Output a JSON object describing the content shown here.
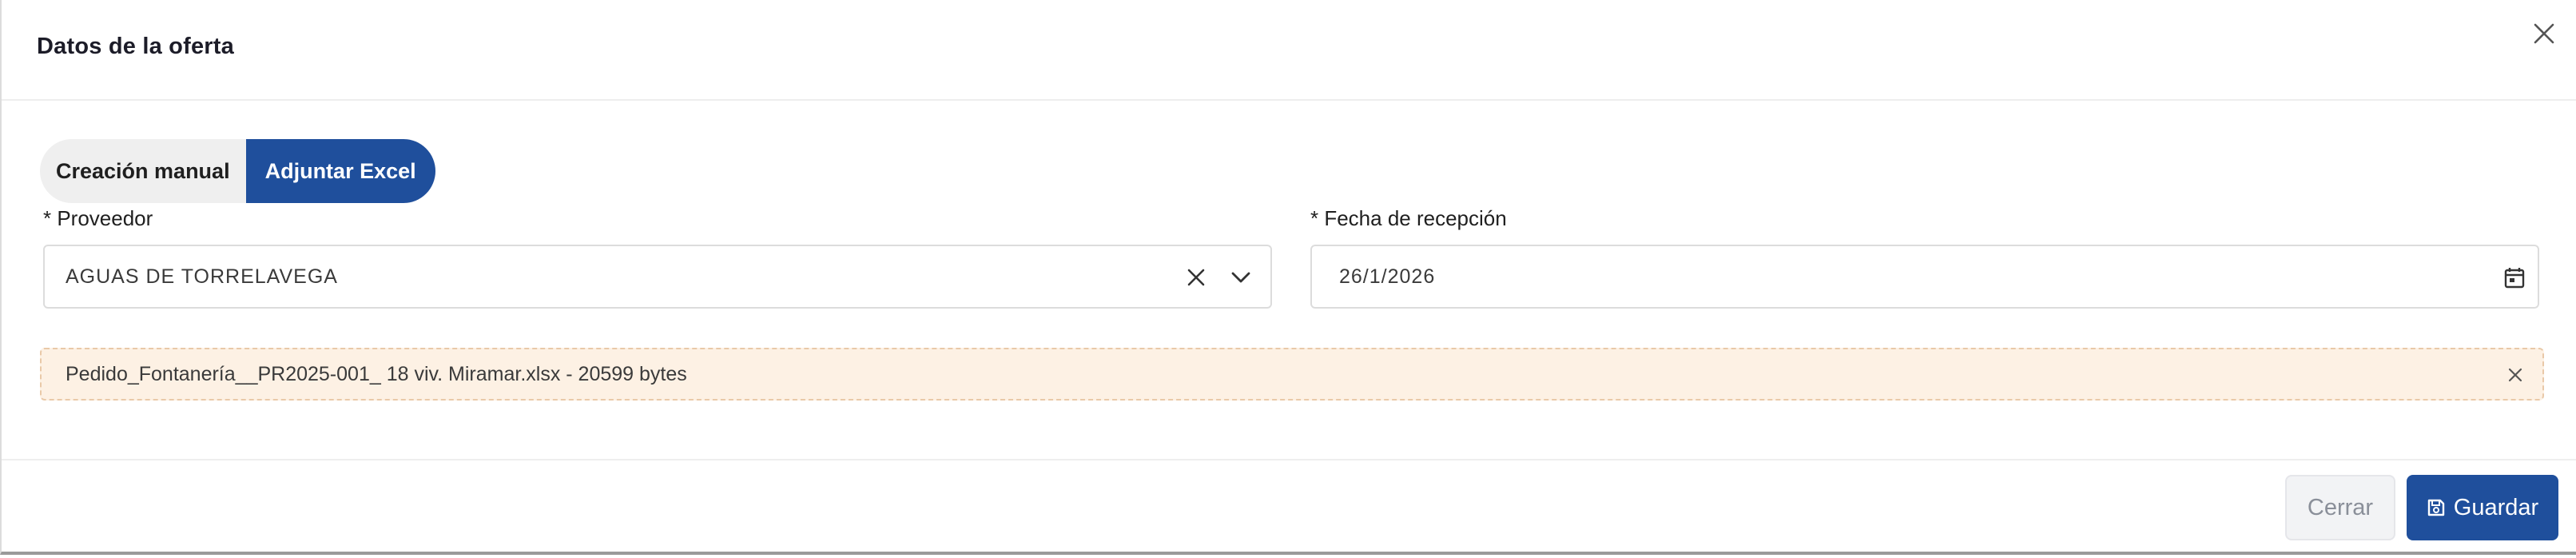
{
  "modal": {
    "title": "Datos de la oferta"
  },
  "tabs": [
    {
      "label": "Creación manual",
      "active": false
    },
    {
      "label": "Adjuntar Excel",
      "active": true
    }
  ],
  "fields": {
    "proveedor": {
      "label": "* Proveedor",
      "value": "AGUAS DE TORRELAVEGA"
    },
    "fecha": {
      "label": "* Fecha de recepción",
      "value": "26/1/2026"
    }
  },
  "attachment": {
    "text": "Pedido_Fontanería__PR2025-001_ 18 viv. Miramar.xlsx - 20599 bytes"
  },
  "footer": {
    "close_label": "Cerrar",
    "save_label": "Guardar"
  },
  "colors": {
    "primary": "#1f4f9c",
    "attachment_bg": "#fdf1e4",
    "attachment_border": "#e9c9a8"
  },
  "icons": [
    "close-icon",
    "clear-icon",
    "chevron-down-icon",
    "calendar-icon",
    "remove-attachment-icon",
    "save-icon"
  ]
}
